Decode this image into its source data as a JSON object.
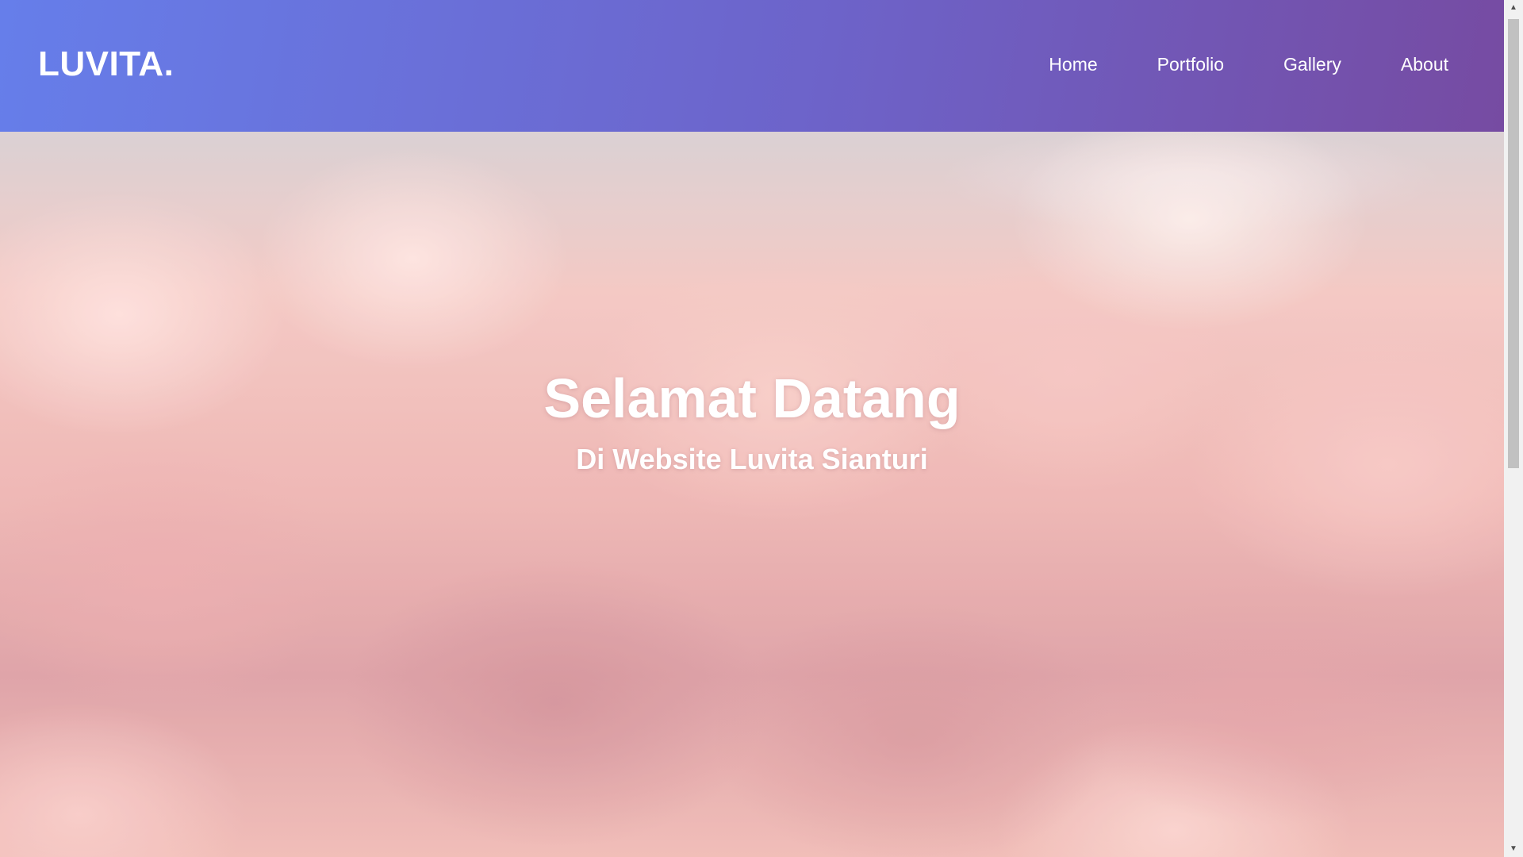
{
  "header": {
    "logo": "LUVITA.",
    "nav": [
      {
        "label": "Home"
      },
      {
        "label": "Portfolio"
      },
      {
        "label": "Gallery"
      },
      {
        "label": "About"
      }
    ]
  },
  "hero": {
    "title": "Selamat Datang",
    "subtitle": "Di Website Luvita Sianturi"
  },
  "colors": {
    "header_gradient_start": "#667eea",
    "header_gradient_end": "#764ba2",
    "text": "#ffffff"
  },
  "icons": {
    "scroll_up": "triangle-up",
    "scroll_down": "triangle-down"
  }
}
